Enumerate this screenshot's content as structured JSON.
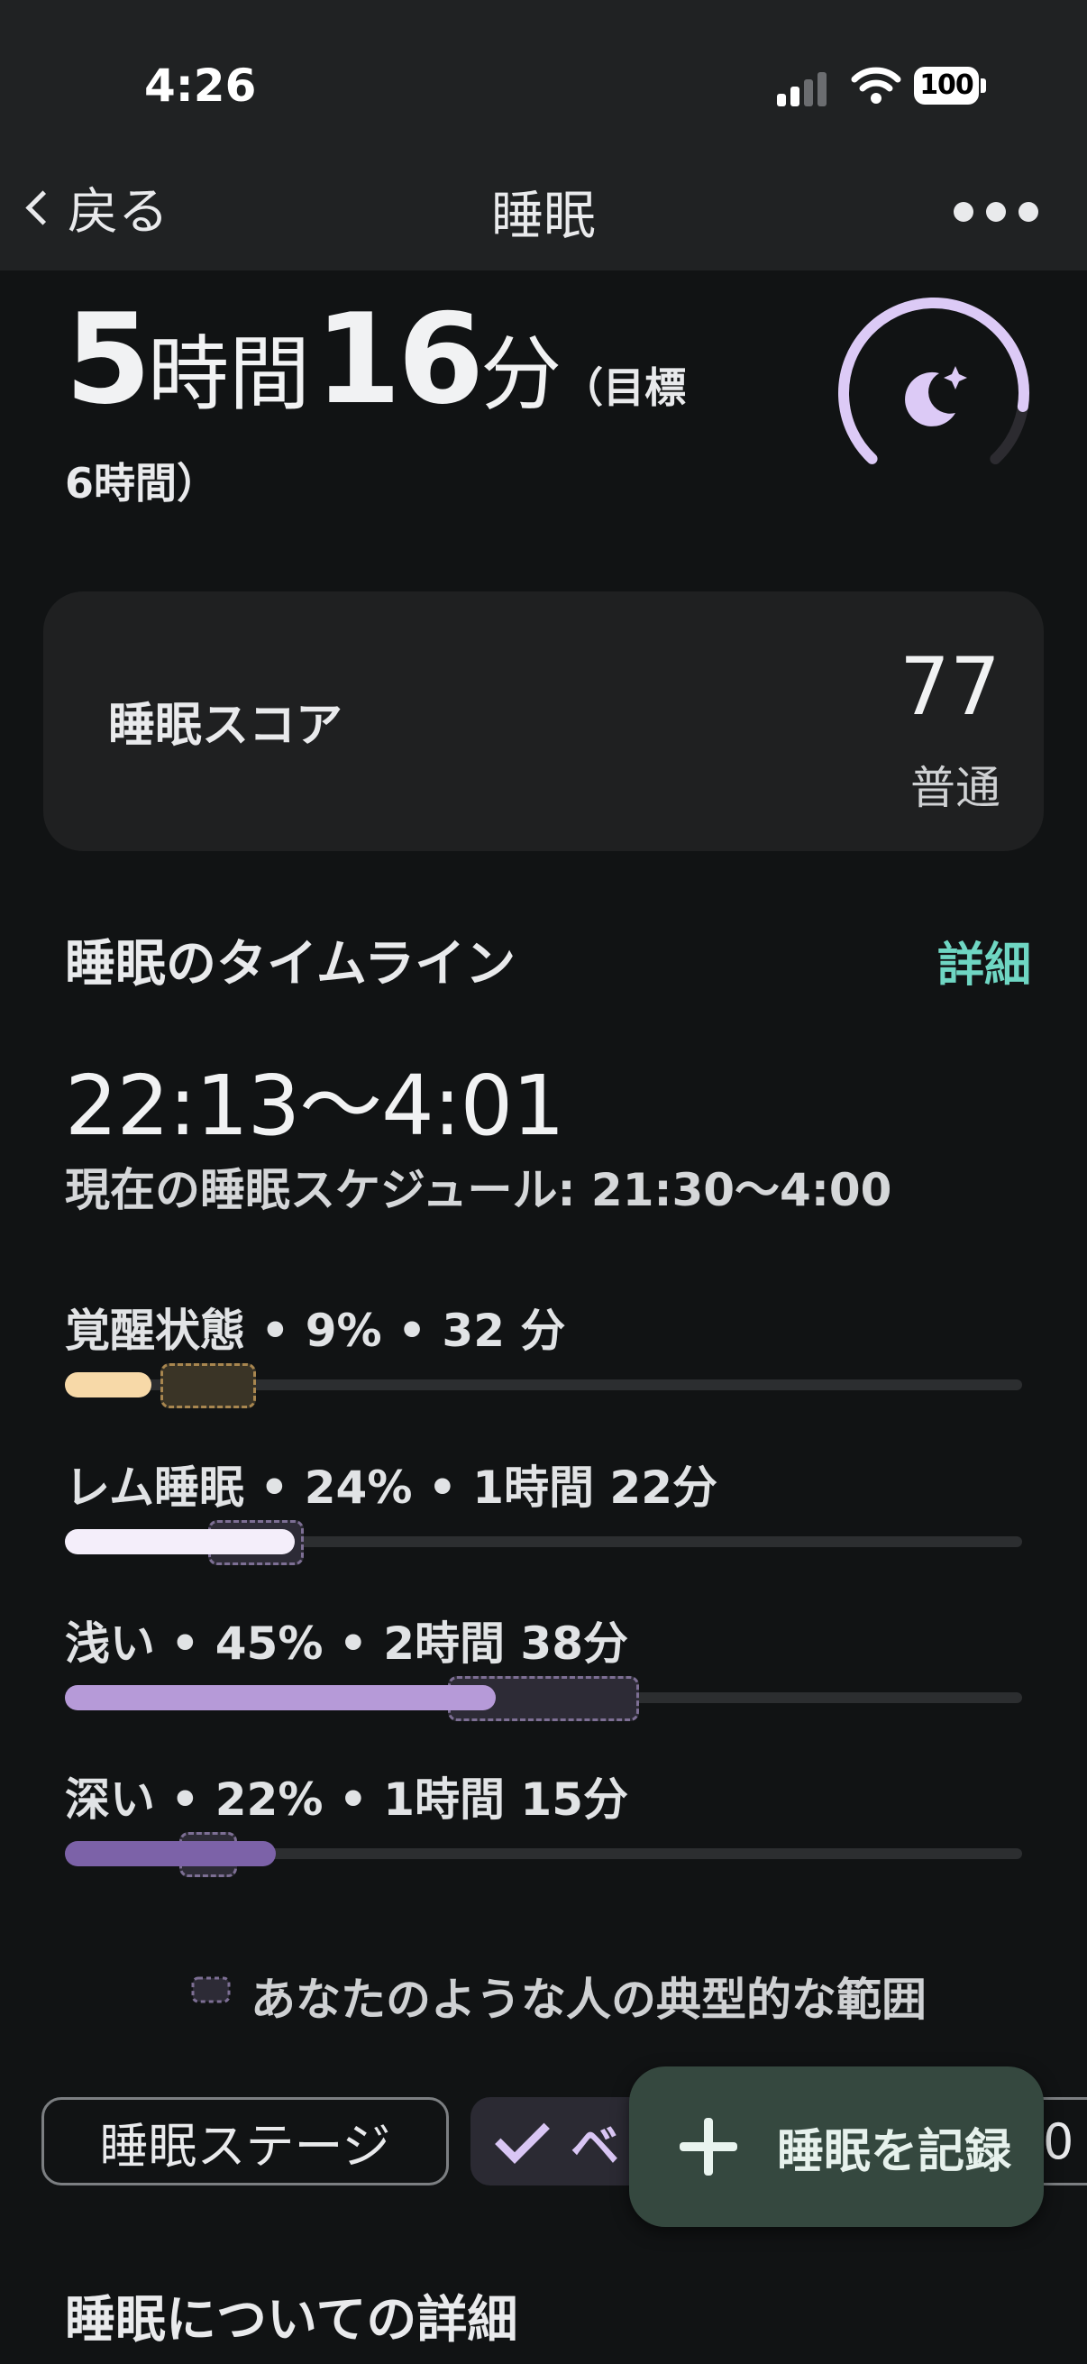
{
  "status_bar": {
    "time": "4:26",
    "battery": "100"
  },
  "nav": {
    "back_label": "戻る",
    "title": "睡眠"
  },
  "duration": {
    "hours": "5",
    "hours_unit": "時間",
    "minutes": "16",
    "minutes_unit": "分",
    "goal_line1": "（目標",
    "goal_line2": "6時間）",
    "ring_progress": 0.86
  },
  "score": {
    "label": "睡眠スコア",
    "value": "77",
    "rating": "普通"
  },
  "timeline": {
    "title": "睡眠のタイムライン",
    "detail_link": "詳細",
    "range": "22:13〜4:01",
    "schedule": "現在の睡眠スケジュール: 21:30〜4:00"
  },
  "stages": [
    {
      "label": "覚醒状態 • 9% • 32 分",
      "percent": 9,
      "typical_range": [
        10,
        20
      ],
      "color": "#f7d9a8",
      "range_color": "#a8864f",
      "range_bg": "#3a3426"
    },
    {
      "label": "レム睡眠 • 24% • 1時間 22分",
      "percent": 24,
      "typical_range": [
        15,
        25
      ],
      "color": "#f4eefa",
      "range_color": "#7d6f94",
      "range_bg": "#2d2b36"
    },
    {
      "label": "浅い • 45% • 2時間 38分",
      "percent": 45,
      "typical_range": [
        40,
        60
      ],
      "color": "#b69ad8",
      "range_color": "#7d6f94",
      "range_bg": "#2d2b36"
    },
    {
      "label": "深い • 22% • 1時間 15分",
      "percent": 22,
      "typical_range": [
        12,
        18
      ],
      "color": "#7c62a8",
      "range_color": "#7d6f94",
      "range_bg": "#2d2b36"
    }
  ],
  "legend": {
    "text": "あなたのような人の典型的な範囲"
  },
  "chips": {
    "stage_chip": "睡眠ステージ",
    "selected_chip": "ベ",
    "third_chip": "0"
  },
  "fab": {
    "label": "睡眠を記録"
  },
  "details_title": "睡眠についての詳細"
}
